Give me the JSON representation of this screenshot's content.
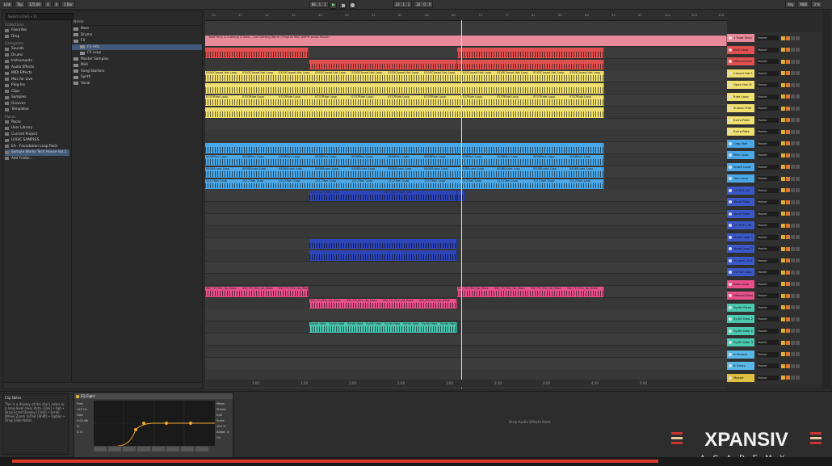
{
  "toolbar": {
    "link": "Link",
    "tap": "Tap",
    "tempo": "125.00",
    "sig_num": "4",
    "sig_den": "4",
    "quant": "1 Bar",
    "position": "86 . 1 . 1",
    "loop_start": "33 . 1 . 1",
    "loop_len": "32 . 0 . 0",
    "key": "Key",
    "midi": "MIDI",
    "cpu": "3 %"
  },
  "browser": {
    "search_placeholder": "Search (Cmd + F)",
    "collections_title": "Collections",
    "collections": [
      "Favorites",
      "Drop"
    ],
    "categories_title": "Categories",
    "categories": [
      "Sounds",
      "Drums",
      "Instruments",
      "Audio Effects",
      "MIDI Effects",
      "Max for Live",
      "Plug-Ins",
      "Clips",
      "Samples",
      "Grooves",
      "Templates"
    ],
    "places_title": "Places",
    "places": [
      "Packs",
      "User Library",
      "Current Project",
      "LOGIC SAMPLES",
      "EA - Foundation Loop Pack",
      "Sample Works Tech House Vol.1",
      "Add Folder..."
    ],
    "name_header": "Name",
    "items": [
      "Bass",
      "Drums",
      "FX",
      "FX Hits",
      "FX Loop",
      "Master Samples",
      "Midi",
      "Song Starters",
      "Synth",
      "Vocal"
    ],
    "selected_item": "FX Hits"
  },
  "arrangement": {
    "ruler": [
      "33",
      "37",
      "41",
      "45",
      "49",
      "53",
      "57",
      "61",
      "65",
      "69",
      "73",
      "77",
      "81",
      "85",
      "89",
      "93",
      "97",
      "101",
      "105",
      "109"
    ],
    "timeline": [
      "1:00",
      "1:30",
      "2:00",
      "2:30",
      "3:00",
      "3:30",
      "4:00",
      "4:30",
      "5:00"
    ],
    "master_clip": "Todd Terry & Luthang & Kody - Just Getting Warm (Original Mix) AMPM audio Master",
    "clip_labels": {
      "closed_hat": "0303Closed Hat Loop",
      "ride": "0707Ride Loop",
      "perc": "0808Perc Loop",
      "snare": "0808Snare Loop",
      "tom": "1212Tom Loop",
      "vox": "KX3_Vox_Hook_124",
      "bass": "SW_TH_Fire_Up_Bass",
      "synth": "Synth Idea"
    }
  },
  "tracks": [
    {
      "name": "1 Todd Terry",
      "color": "#e88a9a"
    },
    {
      "name": "Kick Loop",
      "color": "#e05050"
    },
    {
      "name": "Filtered Kick",
      "color": "#e05050"
    },
    {
      "name": "Closed Hat L",
      "color": "#f0e070"
    },
    {
      "name": "Open Hat M",
      "color": "#f0e070"
    },
    {
      "name": "Ride Loop",
      "color": "#f0e070"
    },
    {
      "name": "Shaker Midi",
      "color": "#f0e070"
    },
    {
      "name": "Extra Ride",
      "color": "#f0e070"
    },
    {
      "name": "Extra Ride",
      "color": "#f0e070"
    },
    {
      "name": "Clap Midi",
      "color": "#4aa8e8"
    },
    {
      "name": "Perc Loop",
      "color": "#4aa8e8"
    },
    {
      "name": "Snare Loop",
      "color": "#4aa8e8"
    },
    {
      "name": "Tom Loop",
      "color": "#4aa8e8"
    },
    {
      "name": "14 KX3_Vo",
      "color": "#3a58c8"
    },
    {
      "name": "Vocal Stab",
      "color": "#3a58c8"
    },
    {
      "name": "Vocal Stab",
      "color": "#3a58c8"
    },
    {
      "name": "17 TFH2_Vo",
      "color": "#3a58c8"
    },
    {
      "name": "Vocal Loop 1",
      "color": "#3a58c8"
    },
    {
      "name": "Vocal Loop 2",
      "color": "#3a58c8"
    },
    {
      "name": "20 shm_124",
      "color": "#3a58c8"
    },
    {
      "name": "21 Full Loop",
      "color": "#3a58c8"
    },
    {
      "name": "Bass Loop",
      "color": "#e8508a"
    },
    {
      "name": "Filtered Bass",
      "color": "#e8508a"
    },
    {
      "name": "Synth Stran",
      "color": "#4ac8b0"
    },
    {
      "name": "Synth Idea 2",
      "color": "#4ac8b0"
    },
    {
      "name": "Synth Idea 1",
      "color": "#4ac8b0"
    },
    {
      "name": "Synth Idea 3",
      "color": "#4ac8b0"
    },
    {
      "name": "A Reverb",
      "color": "#5ab8e8"
    },
    {
      "name": "B Delay",
      "color": "#5ab8e8"
    },
    {
      "name": "Master",
      "color": "#e0c040"
    }
  ],
  "track_output": "Master",
  "clip_notes": {
    "title": "Clip Notes",
    "body": "This is a display of the clip's notes or a loop-level clear data. [Use] • Opt • Drag Scroll Display [Cmd] • Scroll Wheel Zoom In/Out [Shift] • Option • Drag Slide Notes"
  },
  "device": {
    "name": "EQ Eight",
    "freq_label": "Freq",
    "freq_value": "120 Hz",
    "gain_label": "Gain",
    "gain_value": "0.00 dB",
    "q_label": "Q",
    "q_value": "0.71",
    "mode_label": "Mode",
    "mode_value": "Stereo",
    "edit_label": "Edit",
    "scale_label": "Scale",
    "scale_value": "100 %",
    "adapt_label": "Adapt. Q",
    "adapt_value": "On"
  },
  "drop_text": "Drop Audio Effects Here",
  "logo": {
    "main": "XPANSIV",
    "sub": "ACADEMY"
  },
  "progress": 0.8
}
